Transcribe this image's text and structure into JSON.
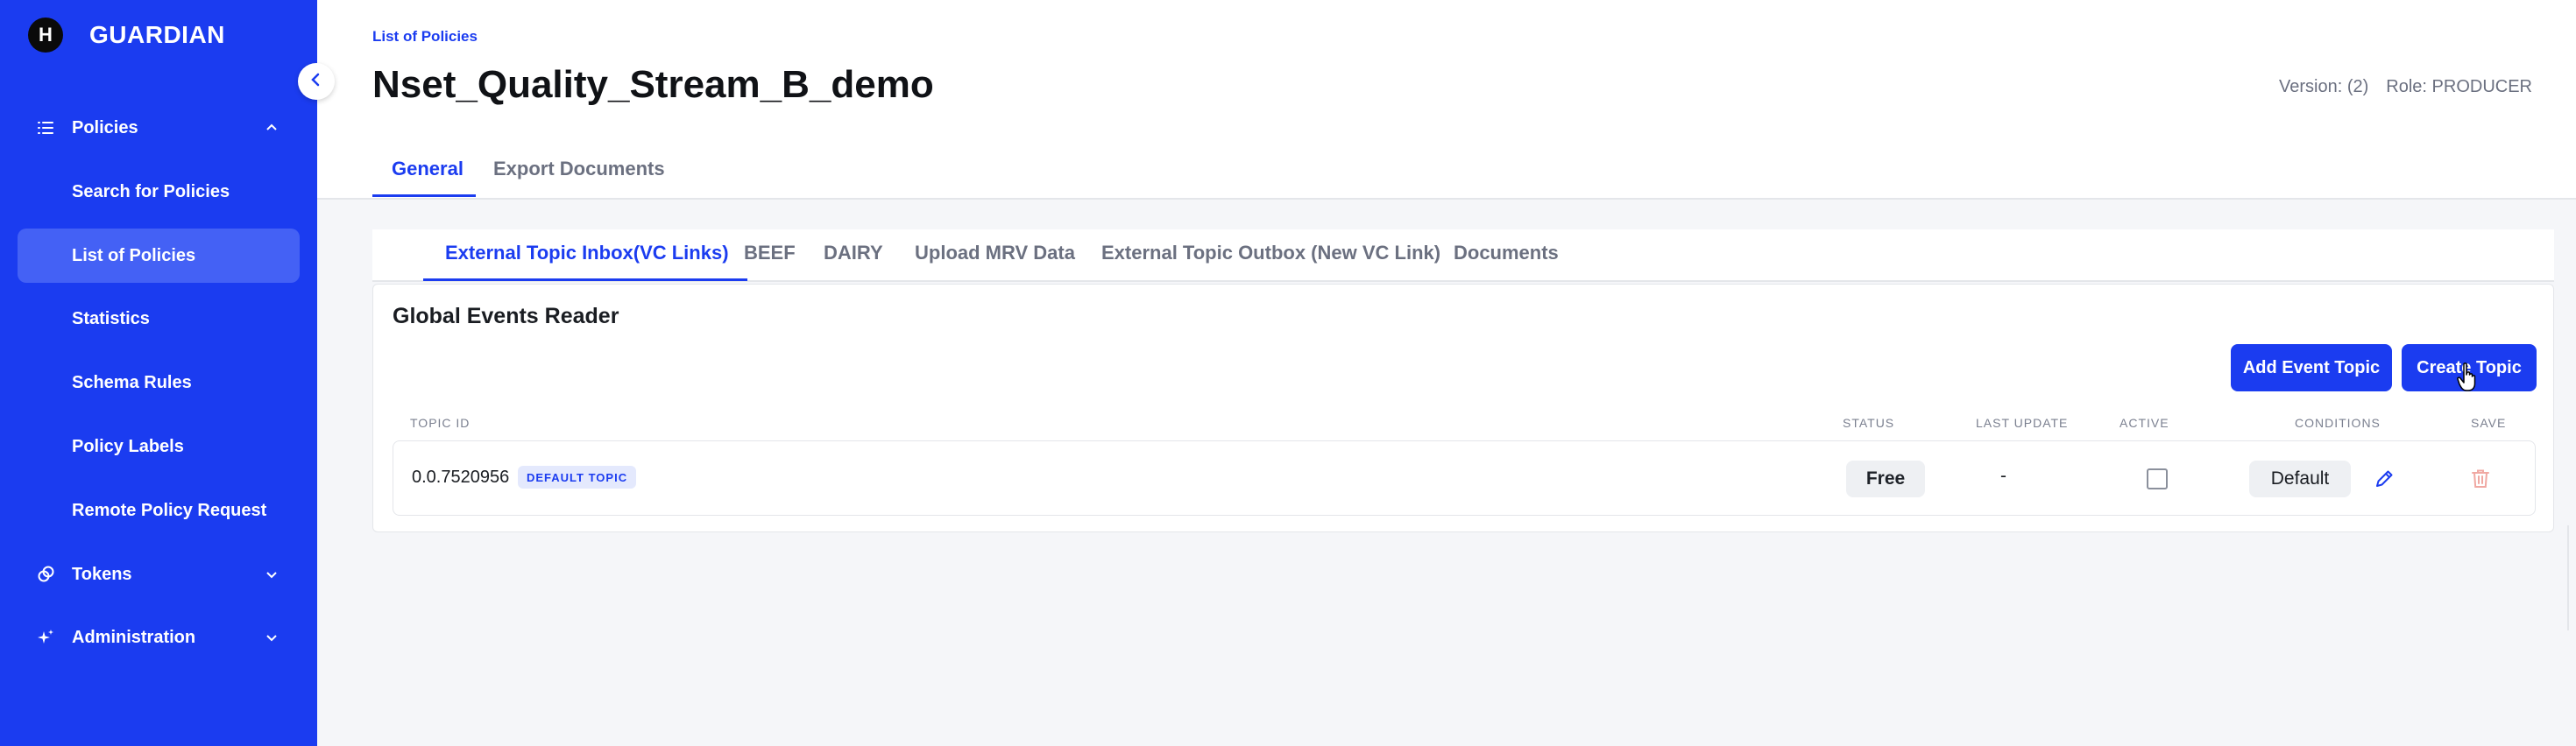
{
  "app": {
    "logo_letter": "H",
    "name": "GUARDIAN",
    "accent_color": "#1b3cf0"
  },
  "sidebar": {
    "groups": [
      {
        "label": "Policies",
        "icon": "list-icon",
        "expanded": true
      },
      {
        "label": "Tokens",
        "icon": "token-icon",
        "expanded": false
      },
      {
        "label": "Administration",
        "icon": "sparkle-icon",
        "expanded": false
      }
    ],
    "policy_items": [
      {
        "label": "Search for Policies"
      },
      {
        "label": "List of Policies",
        "active": true
      },
      {
        "label": "Statistics"
      },
      {
        "label": "Schema Rules"
      },
      {
        "label": "Policy Labels"
      },
      {
        "label": "Remote Policy Request"
      }
    ]
  },
  "header": {
    "breadcrumb": "List of Policies",
    "title": "Nset_Quality_Stream_B_demo",
    "version": "Version: (2)",
    "role": "Role: PRODUCER",
    "tabs": [
      {
        "label": "General",
        "active": true
      },
      {
        "label": "Export Documents",
        "active": false
      }
    ]
  },
  "subtabs": [
    {
      "label": "External Topic Inbox(VC Links)",
      "active": true
    },
    {
      "label": "BEEF"
    },
    {
      "label": "DAIRY"
    },
    {
      "label": "Upload MRV Data"
    },
    {
      "label": "External Topic Outbox (New VC Link)"
    },
    {
      "label": "Documents"
    }
  ],
  "card": {
    "title": "Global Events Reader",
    "add_button": "Add Event Topic",
    "create_button": "Create Topic",
    "columns": {
      "topic_id": "TOPIC ID",
      "status": "STATUS",
      "last_update": "LAST UPDATE",
      "active": "ACTIVE",
      "conditions": "CONDITIONS",
      "save": "SAVE"
    },
    "rows": [
      {
        "topic_id": "0.0.7520956",
        "badge": "DEFAULT TOPIC",
        "status": "Free",
        "last_update": "-",
        "active": false,
        "conditions": "Default"
      }
    ]
  }
}
